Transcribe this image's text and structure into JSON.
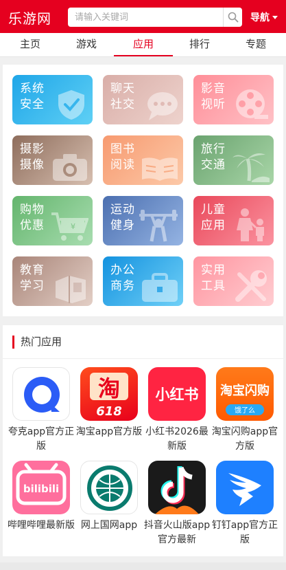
{
  "header": {
    "logo": "乐游网",
    "search_placeholder": "请输入关键词",
    "nav_label": "导航"
  },
  "tabs": [
    {
      "label": "主页",
      "active": false
    },
    {
      "label": "游戏",
      "active": false
    },
    {
      "label": "应用",
      "active": true
    },
    {
      "label": "排行",
      "active": false
    },
    {
      "label": "专题",
      "active": false
    }
  ],
  "categories": [
    {
      "label": "系统安全",
      "icon": "shield-check-icon",
      "colors": [
        "#1fa6e8",
        "#5fd0f5"
      ]
    },
    {
      "label": "聊天社交",
      "icon": "chat-bubble-icon",
      "colors": [
        "#d9aea8",
        "#eed3cd"
      ]
    },
    {
      "label": "影音视听",
      "icon": "film-reel-icon",
      "colors": [
        "#ff8e98",
        "#ffc1c6"
      ]
    },
    {
      "label": "摄影摄像",
      "icon": "camera-icon",
      "colors": [
        "#8e6d5c",
        "#d7bfb0"
      ]
    },
    {
      "label": "图书阅读",
      "icon": "open-book-icon",
      "colors": [
        "#f79a70",
        "#fcc9a8"
      ]
    },
    {
      "label": "旅行交通",
      "icon": "palm-tree-icon",
      "colors": [
        "#6aa36f",
        "#a9d6a8"
      ]
    },
    {
      "label": "购物优惠",
      "icon": "shopping-cart-icon",
      "colors": [
        "#64b56d",
        "#a8ddb0"
      ]
    },
    {
      "label": "运动健身",
      "icon": "barbell-icon",
      "colors": [
        "#4b6fb0",
        "#95b4e3"
      ]
    },
    {
      "label": "儿童应用",
      "icon": "parent-child-icon",
      "colors": [
        "#e9485a",
        "#fb93a0"
      ]
    },
    {
      "label": "教育学习",
      "icon": "books-icon",
      "colors": [
        "#a98579",
        "#e3cfc6"
      ]
    },
    {
      "label": "办公商务",
      "icon": "briefcase-icon",
      "colors": [
        "#1492df",
        "#6fd0f7"
      ]
    },
    {
      "label": "实用工具",
      "icon": "wrench-screwdriver-icon",
      "colors": [
        "#ff95a0",
        "#ffcdd1"
      ]
    }
  ],
  "hot_apps": {
    "title": "热门应用",
    "items": [
      {
        "name": "夸克app官方正版",
        "icon": "quark-app-icon"
      },
      {
        "name": "淘宝app官方版",
        "icon": "taobao-app-icon",
        "icon_text": "淘",
        "icon_subtext": "618"
      },
      {
        "name": "小红书2026最新版",
        "icon": "xiaohongshu-app-icon",
        "icon_text": "小红书"
      },
      {
        "name": "淘宝闪购app官方版",
        "icon": "taobao-shangou-app-icon",
        "icon_text": "淘宝闪购",
        "icon_subtext": "饿了么"
      },
      {
        "name": "哔哩哔哩最新版",
        "icon": "bilibili-app-icon",
        "icon_text": "bilibili"
      },
      {
        "name": "网上国网app",
        "icon": "state-grid-app-icon"
      },
      {
        "name": "抖音火山版app官方最新",
        "icon": "douyin-huoshan-app-icon"
      },
      {
        "name": "钉钉app官方正版",
        "icon": "dingtalk-app-icon"
      }
    ]
  }
}
